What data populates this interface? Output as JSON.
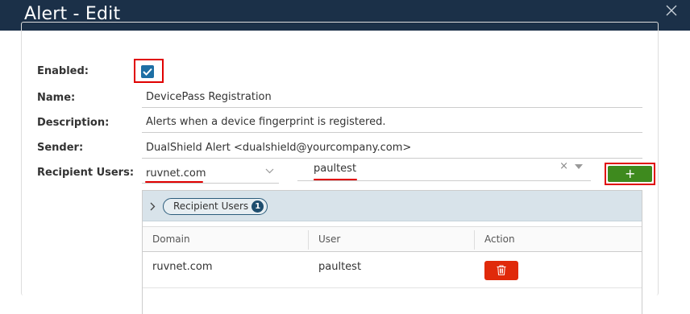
{
  "window": {
    "title": "Alert - Edit",
    "close_icon": "close-icon"
  },
  "form": {
    "enabled": {
      "label": "Enabled:",
      "checked": true
    },
    "name": {
      "label": "Name:",
      "value": "DevicePass Registration"
    },
    "description": {
      "label": "Description:",
      "value": "Alerts when a device fingerprint is registered."
    },
    "sender": {
      "label": "Sender:",
      "value": "DualShield Alert <dualshield@yourcompany.com>"
    },
    "recipient_users": {
      "label": "Recipient Users:",
      "domain_selected": "ruvnet.com",
      "user_selected": "paultest",
      "clear_symbol": "×",
      "add_button_label": "+"
    }
  },
  "recipients_panel": {
    "title": "Recipient Users",
    "count": "1",
    "columns": [
      "Domain",
      "User",
      "Action"
    ],
    "rows": [
      {
        "domain": "ruvnet.com",
        "user": "paultest",
        "action_icon": "trash-icon"
      }
    ]
  },
  "colors": {
    "titlebar": "#1b3048",
    "checkbox": "#1d6fa5",
    "add_button": "#3e8a1e",
    "delete_button": "#e02a0a",
    "highlight": "#e00000"
  }
}
